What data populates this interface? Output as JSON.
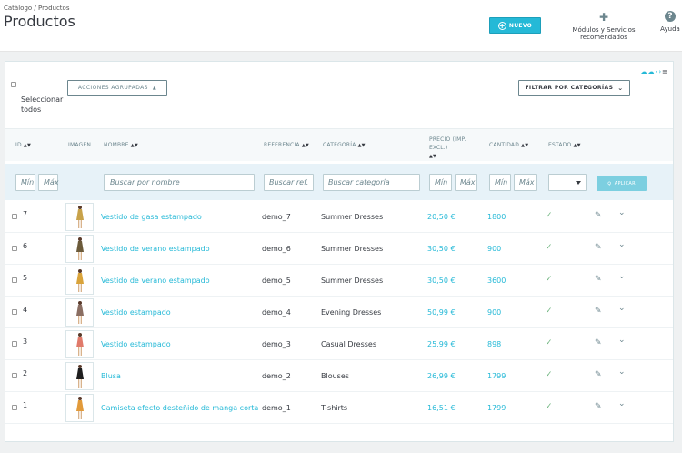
{
  "header": {
    "breadcrumb": "Catálogo / Productos",
    "title": "Productos",
    "new_button": "NUEVO",
    "modules_label": "Módulos y Servicios recomendados",
    "help_label": "Ayuda"
  },
  "toolbar": {
    "select_all_line1": "Seleccionar",
    "select_all_line2": "todos",
    "bulk_actions": "ACCIONES AGRUPADAS",
    "filter_by_category": "FILTRAR POR CATEGORÍAS"
  },
  "columns": {
    "id": "ID",
    "image": "IMAGEN",
    "name": "NOMBRE",
    "reference": "REFERENCIA",
    "category": "CATEGORÍA",
    "price_line1": "PRECIO (IMP. EXCL.)",
    "quantity": "CANTIDAD",
    "status": "ESTADO"
  },
  "filters": {
    "id_min": "Mín",
    "id_max": "Máx",
    "name": "Buscar por nombre",
    "reference": "Buscar ref.",
    "category": "Buscar categoría",
    "price_min": "Mín",
    "price_max": "Máx",
    "qty_min": "Mín",
    "qty_max": "Máx",
    "apply": "APLICAR"
  },
  "products": [
    {
      "id": "7",
      "name": "Vestido de gasa estampado",
      "reference": "demo_7",
      "category": "Summer Dresses",
      "price": "20,50 €",
      "quantity": "1800",
      "color": "#c8a24a"
    },
    {
      "id": "6",
      "name": "Vestido de verano estampado",
      "reference": "demo_6",
      "category": "Summer Dresses",
      "price": "30,50 €",
      "quantity": "900",
      "color": "#6b5a3a"
    },
    {
      "id": "5",
      "name": "Vestido de verano estampado",
      "reference": "demo_5",
      "category": "Summer Dresses",
      "price": "30,50 €",
      "quantity": "3600",
      "color": "#d9a33a"
    },
    {
      "id": "4",
      "name": "Vestido estampado",
      "reference": "demo_4",
      "category": "Evening Dresses",
      "price": "50,99 €",
      "quantity": "900",
      "color": "#8a6e62"
    },
    {
      "id": "3",
      "name": "Vestido estampado",
      "reference": "demo_3",
      "category": "Casual Dresses",
      "price": "25,99 €",
      "quantity": "898",
      "color": "#e07a6a"
    },
    {
      "id": "2",
      "name": "Blusa",
      "reference": "demo_2",
      "category": "Blouses",
      "price": "26,99 €",
      "quantity": "1799",
      "color": "#1e1e1e"
    },
    {
      "id": "1",
      "name": "Camiseta efecto desteñido de manga corta",
      "reference": "demo_1",
      "category": "T-shirts",
      "price": "16,51 €",
      "quantity": "1799",
      "color": "#e29a3a"
    }
  ]
}
